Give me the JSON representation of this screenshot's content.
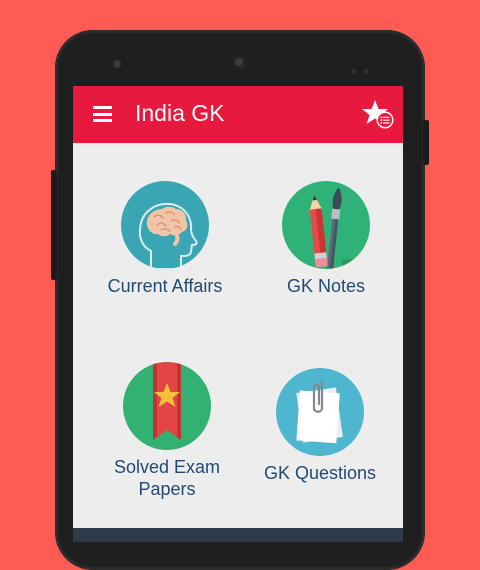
{
  "app": {
    "title": "India GK"
  },
  "appbar": {
    "menu_icon": "hamburger-menu-icon",
    "favorites_icon": "star-list-icon"
  },
  "tiles": [
    {
      "label": "Current Affairs",
      "icon": "brain-head-icon"
    },
    {
      "label": "GK Notes",
      "icon": "pencil-brush-icon"
    },
    {
      "label_line1": "Solved Exam",
      "label_line2": "Papers",
      "icon": "bookmark-star-icon"
    },
    {
      "label": "GK Questions",
      "icon": "paperclip-papers-icon"
    }
  ],
  "colors": {
    "background": "#ff5b55",
    "appbar": "#e8193f",
    "label_text": "#234a73"
  }
}
